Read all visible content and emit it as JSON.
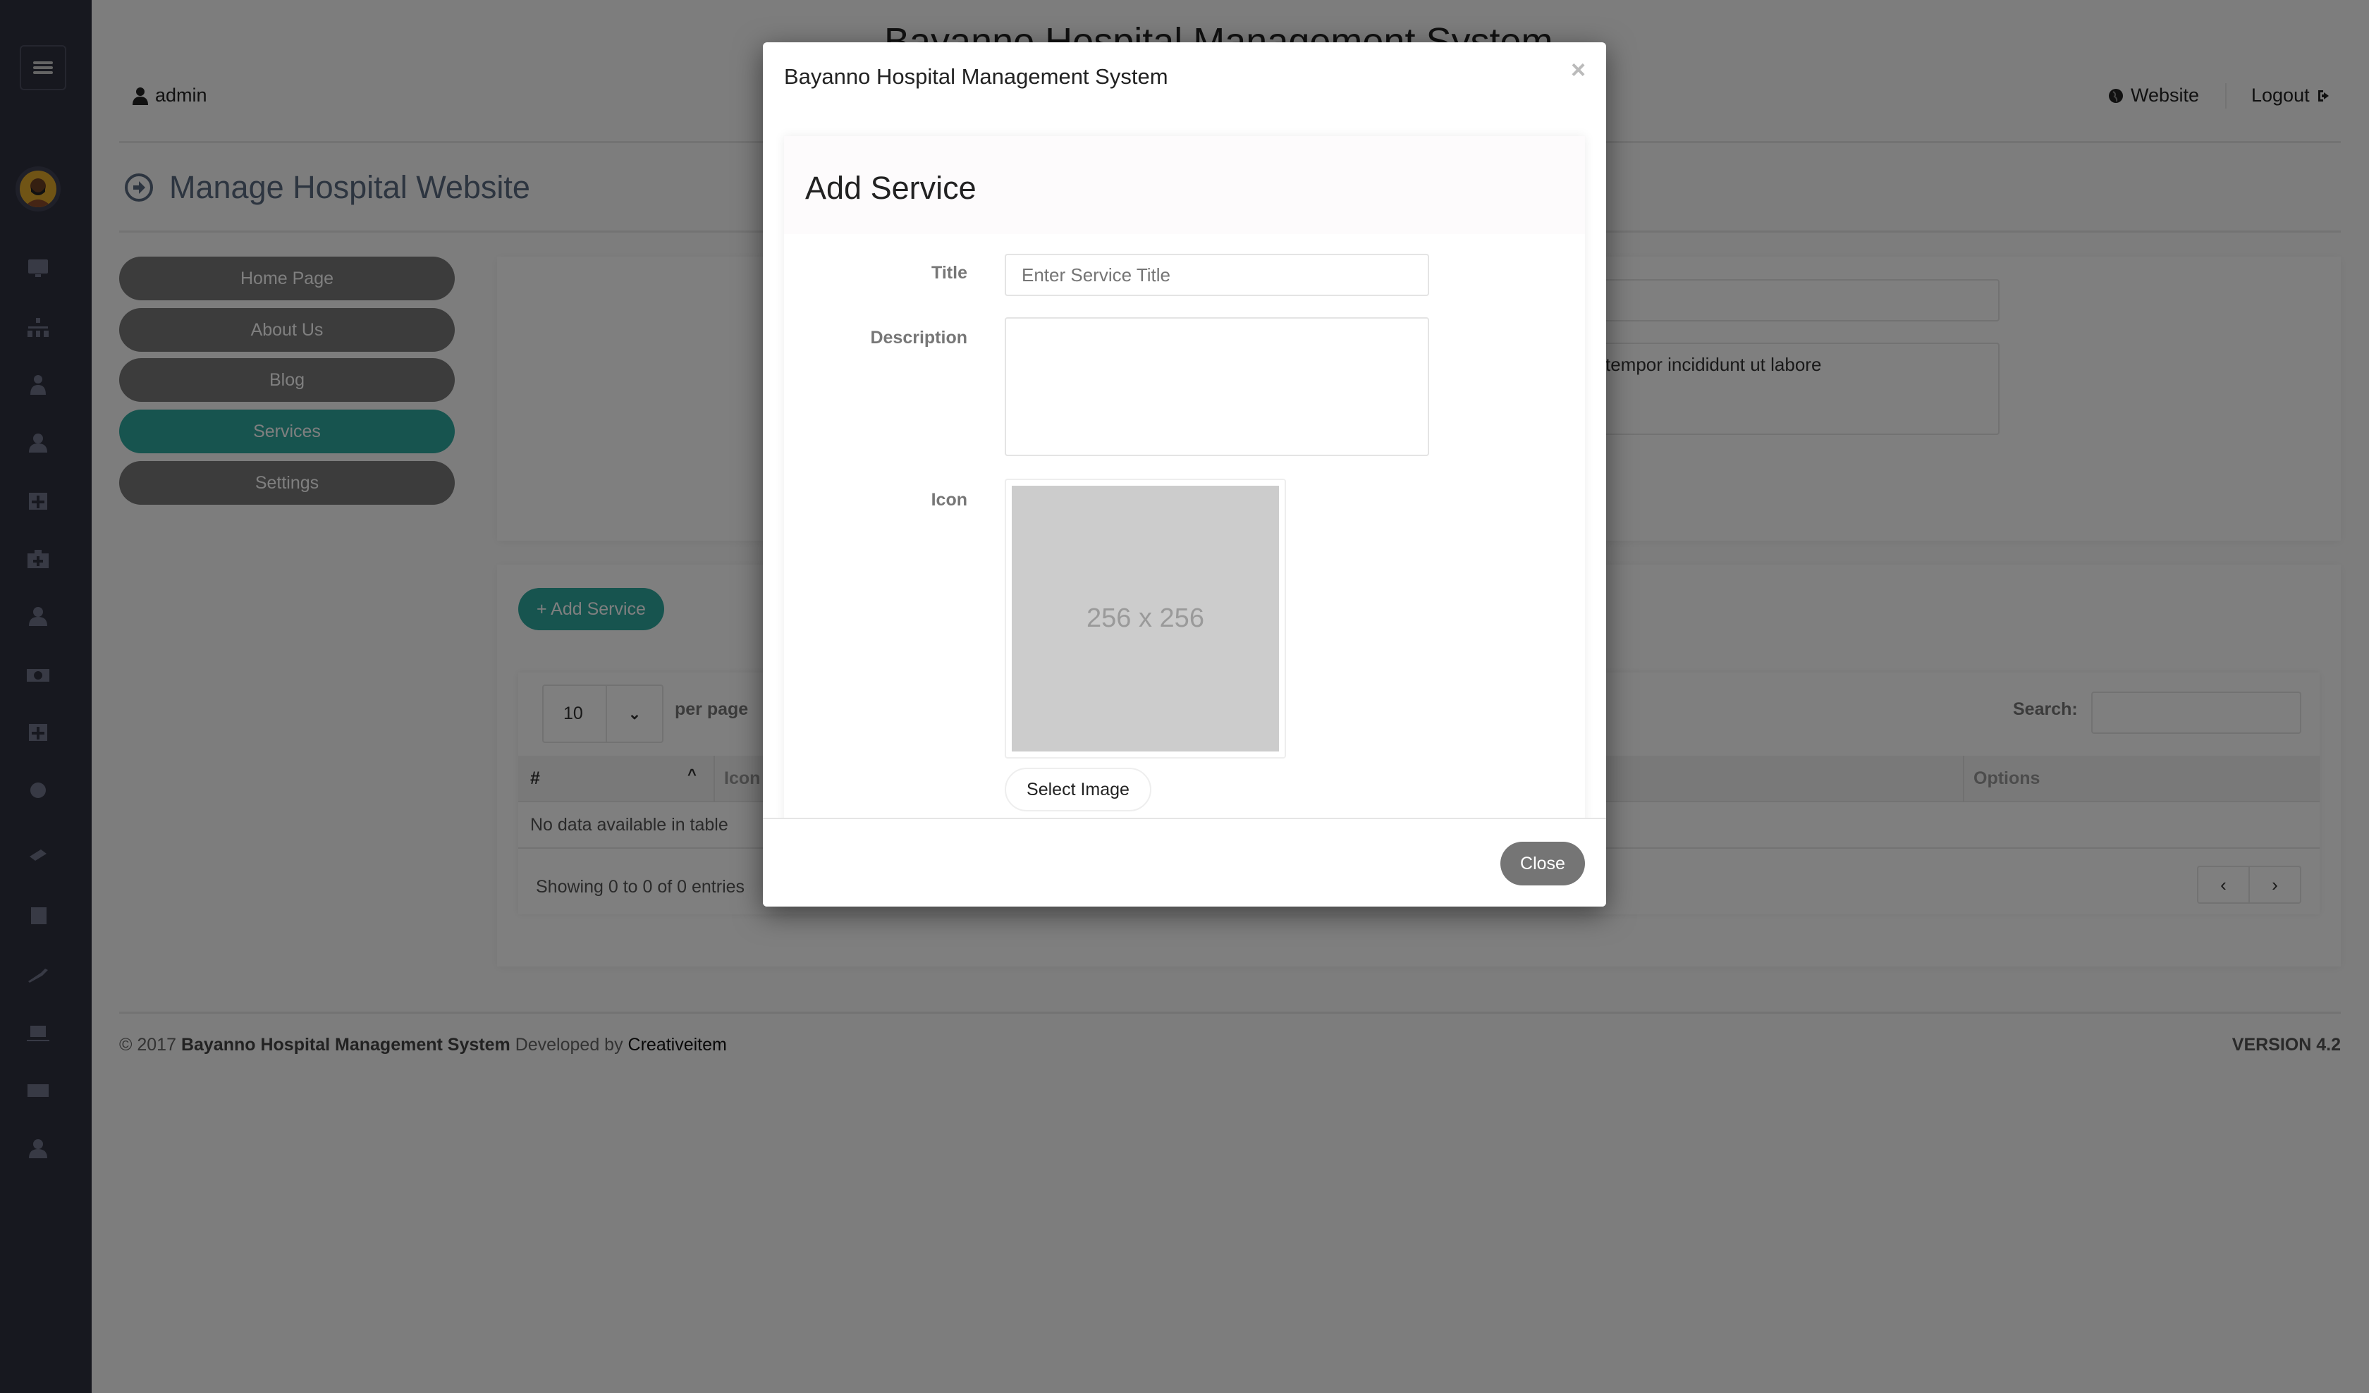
{
  "app_title": "Bayanno Hospital Management System",
  "header": {
    "user": "admin",
    "website_link": "Website",
    "logout_link": "Logout"
  },
  "sidebar": {
    "icons": [
      "desktop-icon",
      "sitemap-icon",
      "doctor-icon",
      "user-icon",
      "plus-square-icon",
      "medkit-icon",
      "user-icon",
      "money-icon",
      "plus-square-icon",
      "sun-icon",
      "tag-icon",
      "list-icon",
      "wrench-icon",
      "laptop-icon",
      "envelope-icon",
      "user-icon"
    ]
  },
  "page": {
    "title": "Manage Hospital Website"
  },
  "nav": [
    {
      "label": "Home Page",
      "active": false
    },
    {
      "label": "About Us",
      "active": false
    },
    {
      "label": "Blog",
      "active": false
    },
    {
      "label": "Services",
      "active": true
    },
    {
      "label": "Settings",
      "active": false
    }
  ],
  "background_form": {
    "textarea_visible_text": "tempor incididunt ut labore"
  },
  "services": {
    "add_button": "+ Add Service",
    "length_value": "10",
    "per_page_label": "per page",
    "search_label": "Search:",
    "columns": [
      "#",
      "Icon",
      "Options"
    ],
    "empty_message": "No data available in table",
    "info": "Showing 0 to 0 of 0 entries",
    "prev": "‹",
    "next": "›"
  },
  "footer": {
    "copyright": "© 2017",
    "system_name": "Bayanno Hospital Management System",
    "developed_by": "Developed by",
    "developer": "Creativeitem",
    "version": "VERSION 4.2"
  },
  "modal": {
    "header_title": "Bayanno Hospital Management System",
    "close_x": "×",
    "heading": "Add Service",
    "title_label": "Title",
    "title_placeholder": "Enter Service Title",
    "title_value": "",
    "description_label": "Description",
    "description_value": "",
    "icon_label": "Icon",
    "image_placeholder": "256 x 256",
    "select_image": "Select Image",
    "close_button": "Close"
  },
  "colors": {
    "accent": "#2ea89e",
    "sidebar": "#2f313f",
    "nav_button": "#787878",
    "close_button": "#757575"
  }
}
